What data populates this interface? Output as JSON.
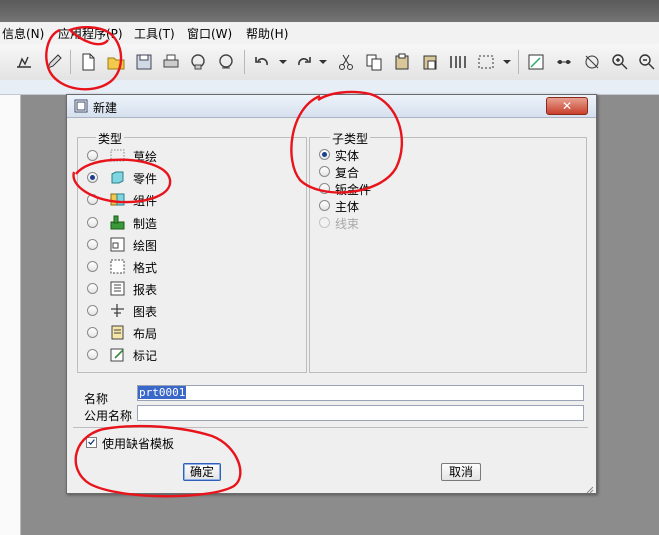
{
  "menu": {
    "info": "信息(N)",
    "apps": "应用程序(P)",
    "tools": "工具(T)",
    "window": "窗口(W)",
    "help": "帮助(H)"
  },
  "dialog": {
    "title": "新建",
    "close_symbol": "✕",
    "type_group_label": "类型",
    "subtype_group_label": "子类型",
    "types": [
      {
        "label": "草绘",
        "checked": false
      },
      {
        "label": "零件",
        "checked": true
      },
      {
        "label": "组件",
        "checked": false
      },
      {
        "label": "制造",
        "checked": false
      },
      {
        "label": "绘图",
        "checked": false
      },
      {
        "label": "格式",
        "checked": false
      },
      {
        "label": "报表",
        "checked": false
      },
      {
        "label": "图表",
        "checked": false
      },
      {
        "label": "布局",
        "checked": false
      },
      {
        "label": "标记",
        "checked": false
      }
    ],
    "subtypes": [
      {
        "label": "实体",
        "checked": true,
        "disabled": false
      },
      {
        "label": "复合",
        "checked": false,
        "disabled": false
      },
      {
        "label": "钣金件",
        "checked": false,
        "disabled": false
      },
      {
        "label": "主体",
        "checked": false,
        "disabled": false
      },
      {
        "label": "线束",
        "checked": false,
        "disabled": true
      }
    ],
    "name_label": "名称",
    "name_value": "prt0001",
    "common_name_label": "公用名称",
    "common_name_value": "",
    "use_default_template_label": "使用缺省模板",
    "use_default_template_checked": true,
    "ok_label": "确定",
    "cancel_label": "取消"
  },
  "annotation_color": "#e8141c"
}
